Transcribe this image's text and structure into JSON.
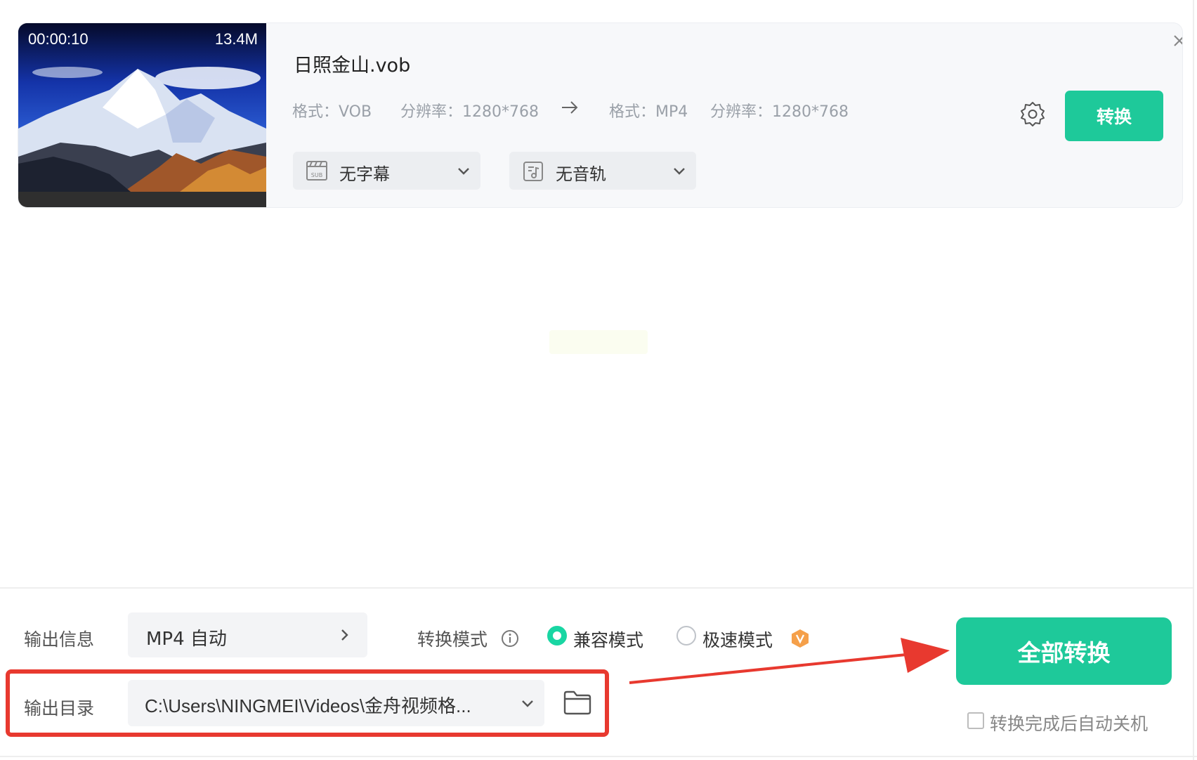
{
  "file": {
    "thumbnail": {
      "duration": "00:00:10",
      "size": "13.4M"
    },
    "name": "日照金山.vob",
    "source": {
      "format": "格式：VOB",
      "resolution": "分辨率：1280*768"
    },
    "target": {
      "format": "格式：MP4",
      "resolution": "分辨率：1280*768"
    },
    "subtitle_select": "无字幕",
    "audio_select": "无音轨",
    "convert_label": "转换"
  },
  "footer": {
    "output_info_label": "输出信息",
    "output_format_value": "MP4 自动",
    "mode_label": "转换模式",
    "mode_options": [
      "兼容模式",
      "极速模式"
    ],
    "mode_selected": "兼容模式",
    "output_dir_label": "输出目录",
    "output_dir_value": "C:\\Users\\NINGMEI\\Videos\\金舟视频格...",
    "convert_all_label": "全部转换",
    "shutdown_label": "转换完成后自动关机",
    "shutdown_checked": false
  },
  "colors": {
    "accent": "#1ec99a",
    "radio_active": "#19d6a3",
    "highlight": "#e8392f",
    "vip": "#f5a04a"
  },
  "icons": [
    "arrow-right-icon",
    "subtitle-icon",
    "audio-track-icon",
    "chevron-down-icon",
    "gear-icon",
    "close-icon",
    "chevron-right-icon",
    "info-icon",
    "vip-icon",
    "folder-icon"
  ]
}
